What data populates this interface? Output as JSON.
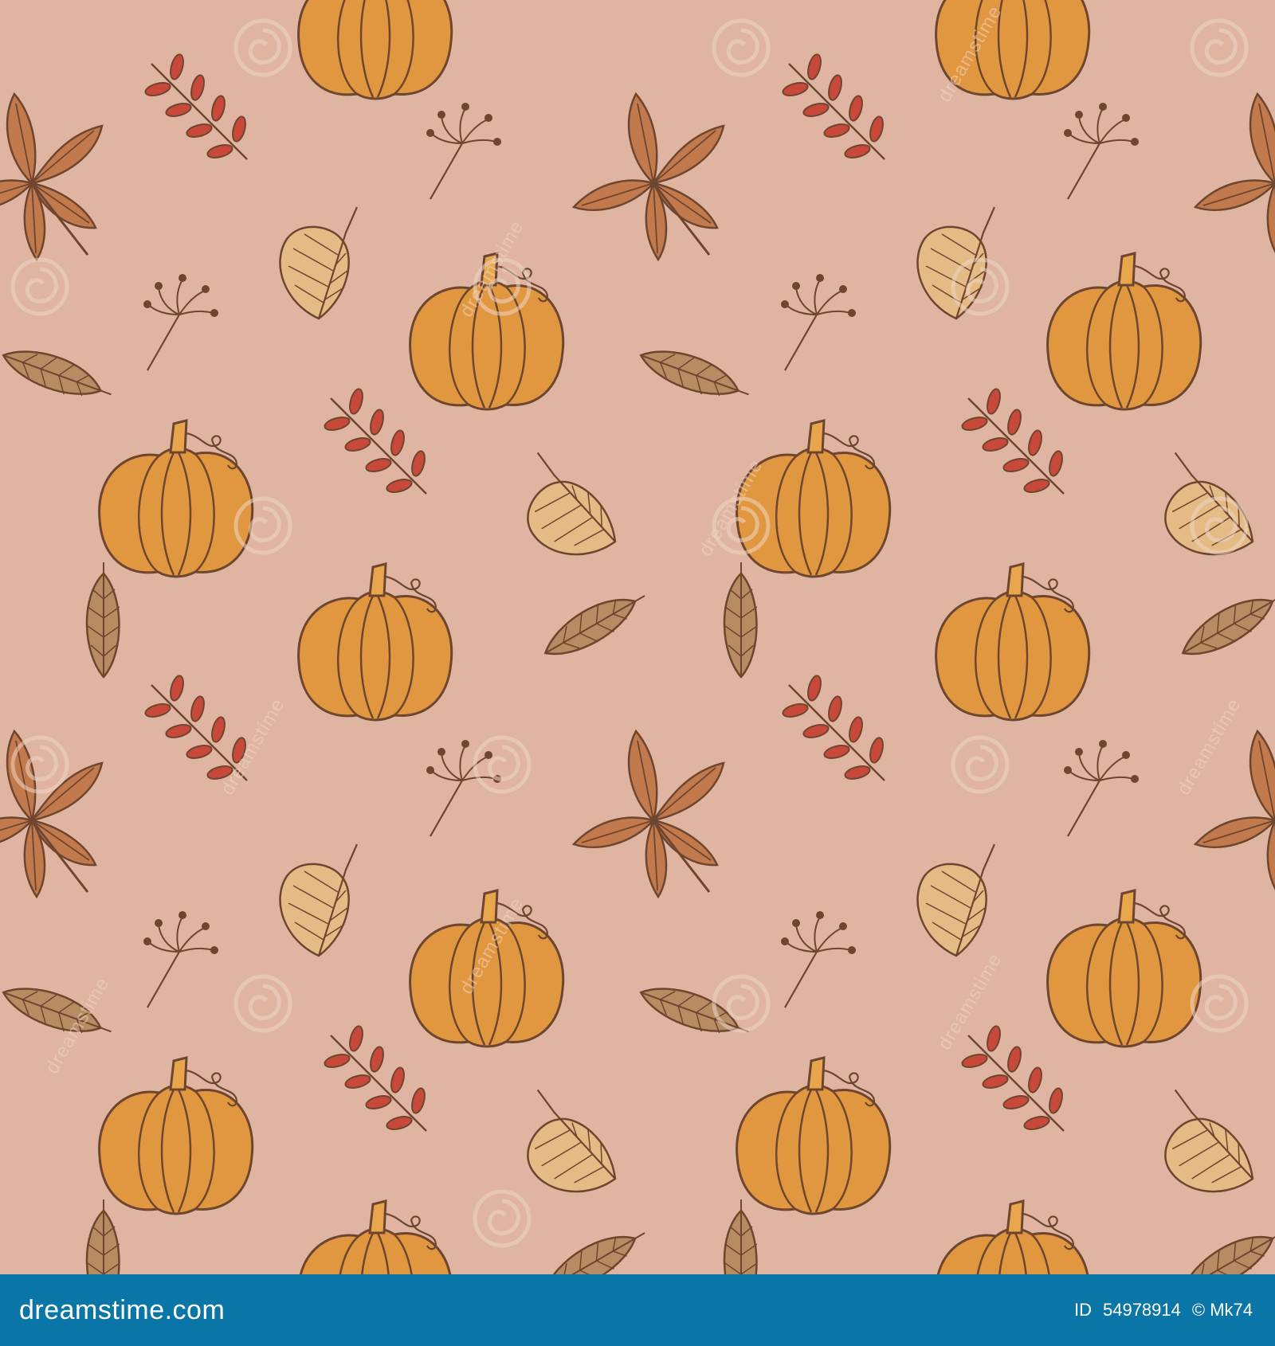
{
  "colors": {
    "background": "#dfb4a0",
    "footer": "#0a76a7",
    "footer_text": "#ffffff",
    "outline": "#6e4630",
    "pumpkin": "#e1973f",
    "pumpkin_light": "#e7a64b",
    "leaf_brown": "#c27a4c",
    "leaf_tan": "#e4bb85",
    "leaf_olive": "#b78c63",
    "berry_red": "#c8493a",
    "watermark": "#f0d5c6"
  },
  "icons": [
    "pumpkin-icon",
    "chestnut-leaf-icon",
    "linden-leaf-icon",
    "oval-leaf-icon",
    "rowan-sprig-icon",
    "berry-sprig-icon",
    "watermark-spiral-icon"
  ],
  "watermark": {
    "text": "dreamstime"
  },
  "footer": {
    "logo": "dreamstime.com",
    "id_label": "ID",
    "id_number": "54978914",
    "author": "© Mk74"
  }
}
